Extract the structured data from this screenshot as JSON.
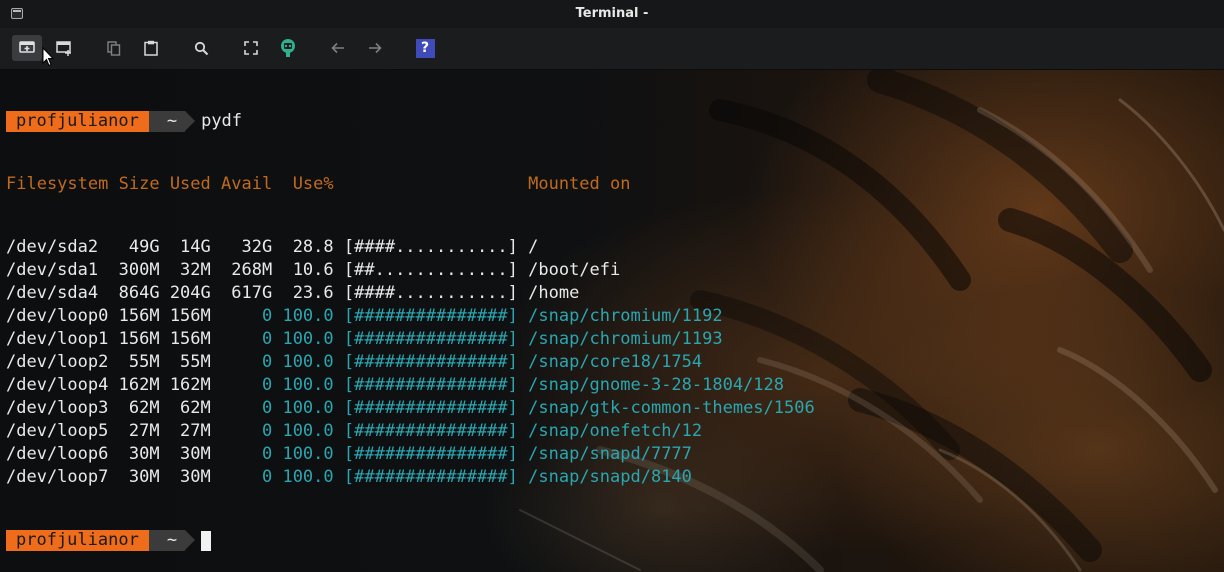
{
  "window": {
    "title": "Terminal -"
  },
  "toolbar": {
    "buttons": [
      {
        "name": "new-tab",
        "icon": "new-tab-icon"
      },
      {
        "name": "new-window",
        "icon": "new-window-icon"
      },
      {
        "name": "copy",
        "icon": "copy-icon"
      },
      {
        "name": "paste",
        "icon": "paste-icon"
      },
      {
        "name": "search",
        "icon": "search-icon"
      },
      {
        "name": "fullscreen",
        "icon": "fullscreen-icon"
      },
      {
        "name": "unsafe-paste",
        "icon": "robot-icon"
      },
      {
        "name": "back",
        "icon": "arrow-left-icon"
      },
      {
        "name": "forward",
        "icon": "arrow-right-icon"
      },
      {
        "name": "help",
        "icon": "help-icon",
        "label": "?"
      }
    ]
  },
  "prompt": {
    "user": "profjulianor",
    "dir": "~",
    "command": "pydf"
  },
  "header": {
    "filesystem": "Filesystem",
    "size": "Size",
    "used": "Used",
    "avail": "Avail",
    "use": "Use%",
    "mounted": "Mounted on"
  },
  "rows": [
    {
      "fs": "/dev/sda2",
      "size": "49G",
      "used": "14G",
      "avail": "32G",
      "pct": "28.8",
      "bar": "[####...........]",
      "mount": "/",
      "full": false
    },
    {
      "fs": "/dev/sda1",
      "size": "300M",
      "used": "32M",
      "avail": "268M",
      "pct": "10.6",
      "bar": "[##.............]",
      "mount": "/boot/efi",
      "full": false
    },
    {
      "fs": "/dev/sda4",
      "size": "864G",
      "used": "204G",
      "avail": "617G",
      "pct": "23.6",
      "bar": "[####...........]",
      "mount": "/home",
      "full": false
    },
    {
      "fs": "/dev/loop0",
      "size": "156M",
      "used": "156M",
      "avail": "0",
      "pct": "100.0",
      "bar": "[###############]",
      "mount": "/snap/chromium/1192",
      "full": true
    },
    {
      "fs": "/dev/loop1",
      "size": "156M",
      "used": "156M",
      "avail": "0",
      "pct": "100.0",
      "bar": "[###############]",
      "mount": "/snap/chromium/1193",
      "full": true
    },
    {
      "fs": "/dev/loop2",
      "size": "55M",
      "used": "55M",
      "avail": "0",
      "pct": "100.0",
      "bar": "[###############]",
      "mount": "/snap/core18/1754",
      "full": true
    },
    {
      "fs": "/dev/loop4",
      "size": "162M",
      "used": "162M",
      "avail": "0",
      "pct": "100.0",
      "bar": "[###############]",
      "mount": "/snap/gnome-3-28-1804/128",
      "full": true
    },
    {
      "fs": "/dev/loop3",
      "size": "62M",
      "used": "62M",
      "avail": "0",
      "pct": "100.0",
      "bar": "[###############]",
      "mount": "/snap/gtk-common-themes/1506",
      "full": true
    },
    {
      "fs": "/dev/loop5",
      "size": "27M",
      "used": "27M",
      "avail": "0",
      "pct": "100.0",
      "bar": "[###############]",
      "mount": "/snap/onefetch/12",
      "full": true
    },
    {
      "fs": "/dev/loop6",
      "size": "30M",
      "used": "30M",
      "avail": "0",
      "pct": "100.0",
      "bar": "[###############]",
      "mount": "/snap/snapd/7777",
      "full": true
    },
    {
      "fs": "/dev/loop7",
      "size": "30M",
      "used": "30M",
      "avail": "0",
      "pct": "100.0",
      "bar": "[###############]",
      "mount": "/snap/snapd/8140",
      "full": true
    }
  ],
  "colors": {
    "prompt_user_bg": "#ef6c1a",
    "prompt_dir_bg": "#3b3b3b",
    "header": "#c16a1e",
    "full_usage": "#2aa6b0"
  }
}
